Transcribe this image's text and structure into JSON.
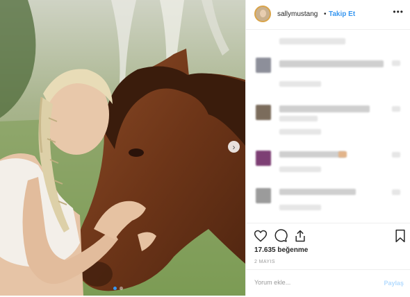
{
  "post": {
    "username": "sallymustang",
    "separator": "•",
    "follow_label": "Takip Et",
    "more_label": "•••",
    "likes_text": "17.635 beğenme",
    "date_text": "2 MAYIS",
    "comment_placeholder": "Yorum ekle...",
    "share_label": "Paylaş",
    "carousel": {
      "count": 2,
      "current": 1
    }
  },
  "colors": {
    "accent": "#3897f0",
    "share_disabled": "#b3dbff",
    "text": "#262626",
    "muted": "#999999"
  },
  "icons": {
    "like": "heart-icon",
    "comment": "comment-bubble-icon",
    "share": "share-icon",
    "save": "bookmark-icon",
    "next": "chevron-right-icon"
  }
}
